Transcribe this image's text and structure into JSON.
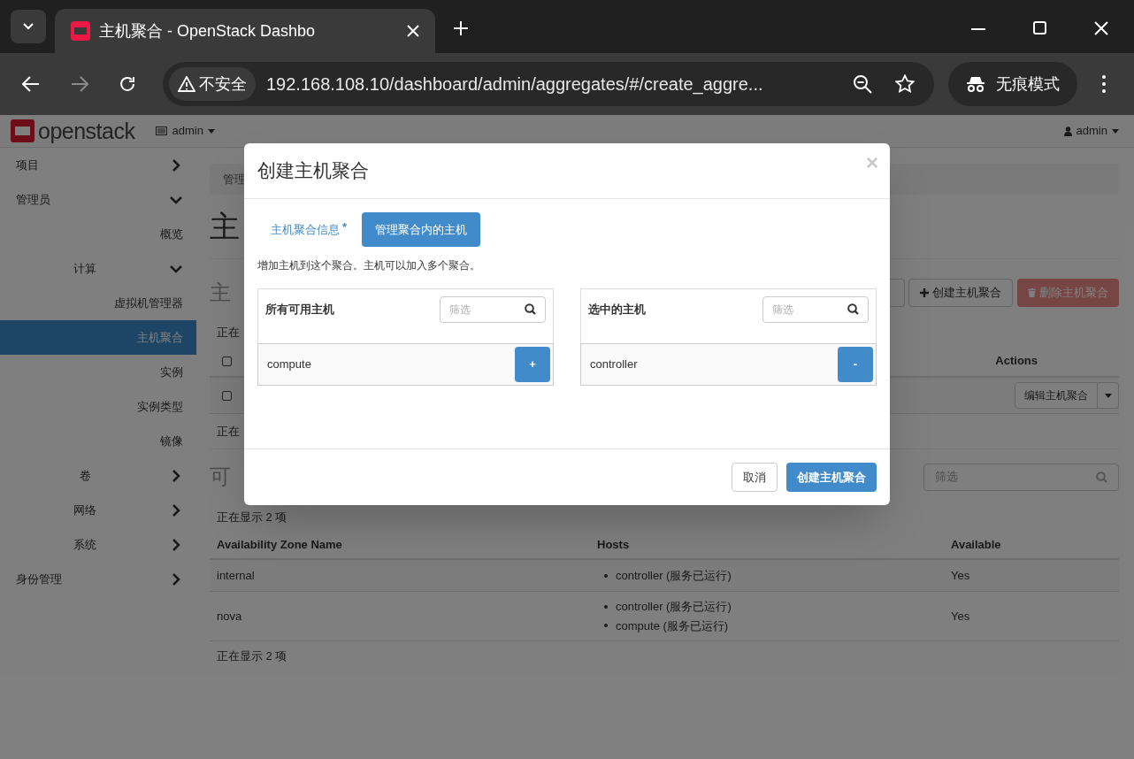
{
  "browser": {
    "tab_title": "主机聚合 - OpenStack Dashbo",
    "security_label": "不安全",
    "url": "192.168.108.10/dashboard/admin/aggregates/#/create_aggre...",
    "incognito_label": "无痕模式"
  },
  "header": {
    "logo_text": "openstack",
    "project": "admin",
    "user": "admin"
  },
  "sidebar": {
    "items": [
      {
        "label": "项目",
        "kind": "group",
        "expanded": false
      },
      {
        "label": "管理员",
        "kind": "group",
        "expanded": true,
        "children": [
          {
            "label": "概览",
            "kind": "link",
            "selected": false
          },
          {
            "label": "计算",
            "kind": "group",
            "expanded": true,
            "children": [
              {
                "label": "虚拟机管理器",
                "kind": "link",
                "selected": false
              },
              {
                "label": "主机聚合",
                "kind": "link",
                "selected": true
              },
              {
                "label": "实例",
                "kind": "link",
                "selected": false
              },
              {
                "label": "实例类型",
                "kind": "link",
                "selected": false
              },
              {
                "label": "镜像",
                "kind": "link",
                "selected": false
              }
            ]
          },
          {
            "label": "卷",
            "kind": "group",
            "expanded": false
          },
          {
            "label": "网络",
            "kind": "group",
            "expanded": false
          },
          {
            "label": "系统",
            "kind": "group",
            "expanded": false
          }
        ]
      },
      {
        "label": "身份管理",
        "kind": "group",
        "expanded": false
      }
    ]
  },
  "page": {
    "breadcrumb": "管理",
    "title": "主",
    "aggregates": {
      "heading": "主",
      "count_top": "正在",
      "create_button": "创建主机聚合",
      "delete_button": "删除主机聚合",
      "header_checkbox": {
        "checked": false
      },
      "actions_header": "Actions",
      "rows": [
        {
          "checked": false,
          "action": "编辑主机聚合"
        }
      ],
      "count_bottom": "正在"
    },
    "zones": {
      "heading": "可",
      "filter_placeholder": "筛选",
      "count_top": "正在显示 2 项",
      "columns": [
        "Availability Zone Name",
        "Hosts",
        "Available"
      ],
      "rows": [
        {
          "name": "internal",
          "hosts": [
            "controller (服务已运行)"
          ],
          "available": "Yes"
        },
        {
          "name": "nova",
          "hosts": [
            "controller (服务已运行)",
            "compute (服务已运行)"
          ],
          "available": "Yes"
        }
      ],
      "count_bottom": "正在显示 2 项"
    }
  },
  "modal": {
    "title": "创建主机聚合",
    "close": "×",
    "tabs": [
      {
        "label": "主机聚合信息",
        "required_mark": "*",
        "selected": false
      },
      {
        "label": "管理聚合内的主机",
        "selected": true
      }
    ],
    "help": "增加主机到这个聚合。主机可以加入多个聚合。",
    "lists": [
      {
        "title": "所有可用主机",
        "filter_placeholder": "筛选",
        "items": [
          {
            "name": "compute",
            "action": "+"
          }
        ]
      },
      {
        "title": "选中的主机",
        "filter_placeholder": "筛选",
        "items": [
          {
            "name": "controller",
            "action": "-"
          }
        ]
      }
    ],
    "cancel": "取消",
    "submit": "创建主机聚合"
  }
}
